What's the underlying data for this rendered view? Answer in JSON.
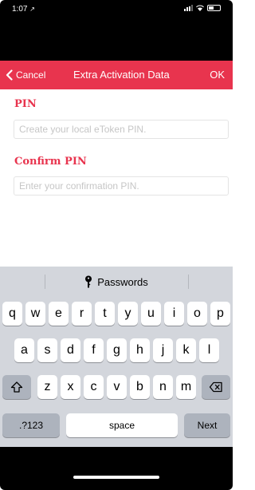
{
  "status_bar": {
    "time": "1:07",
    "location_arrow": "↗"
  },
  "nav": {
    "cancel_label": "Cancel",
    "title": "Extra Activation Data",
    "ok_label": "OK",
    "accent_color": "#e8344e"
  },
  "form": {
    "pin_label": "PIN",
    "pin_placeholder": "Create your local eToken PIN.",
    "pin_value": "",
    "confirm_label": "Confirm PIN",
    "confirm_placeholder": "Enter your confirmation PIN.",
    "confirm_value": ""
  },
  "keyboard": {
    "suggestion": "Passwords",
    "row1": [
      "q",
      "w",
      "e",
      "r",
      "t",
      "y",
      "u",
      "i",
      "o",
      "p"
    ],
    "row2": [
      "a",
      "s",
      "d",
      "f",
      "g",
      "h",
      "j",
      "k",
      "l"
    ],
    "row3": [
      "z",
      "x",
      "c",
      "v",
      "b",
      "n",
      "m"
    ],
    "numbers_key": ".?123",
    "space_key": "space",
    "next_key": "Next",
    "shift_icon": "shift-arrow-icon",
    "delete_icon": "backspace-icon"
  }
}
